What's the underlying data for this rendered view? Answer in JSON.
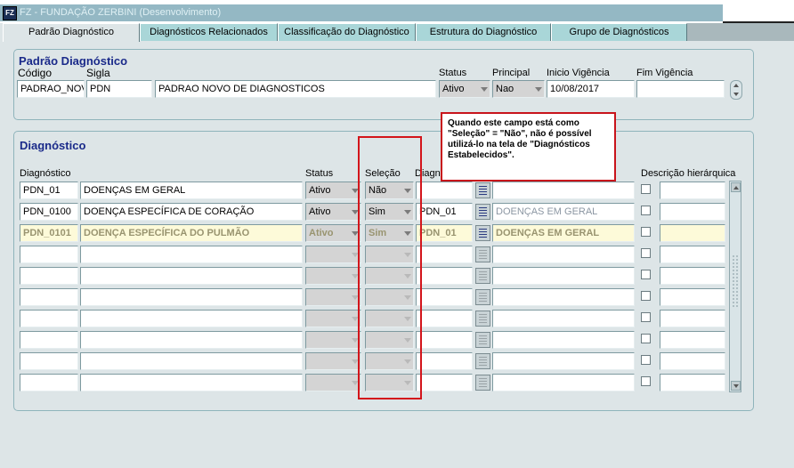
{
  "window": {
    "title": "FZ - FUNDAÇÃO ZERBINI (Desenvolvimento)",
    "icon": "app-icon"
  },
  "tabs": [
    {
      "label": "Padrão Diagnóstico",
      "active": true
    },
    {
      "label": "Diagnósticos Relacionados",
      "active": false
    },
    {
      "label": "Classificação do Diagnóstico",
      "active": false
    },
    {
      "label": "Estrutura do Diagnóstico",
      "active": false
    },
    {
      "label": "Grupo de Diagnósticos",
      "active": false
    }
  ],
  "header": {
    "title": "Padrão Diagnóstico",
    "labels": {
      "codigo": "Código",
      "sigla": "Sigla",
      "status": "Status",
      "principal": "Principal",
      "inicio": "Inicio Vigência",
      "fim": "Fim Vigência"
    },
    "codigo": "PADRAO_NOV",
    "sigla": "PDN",
    "descricao": "PADRAO NOVO DE DIAGNOSTICOS",
    "status": "Ativo",
    "principal": "Nao",
    "inicio": "10/08/2017",
    "fim": ""
  },
  "diag": {
    "title": "Diagnóstico",
    "columns": {
      "diagnostico": "Diagnóstico",
      "status": "Status",
      "selecao": "Seleção",
      "diag_pai": "Diagn",
      "descr_hier": "Descrição hierárquica"
    },
    "rows": [
      {
        "codigo": "PDN_01",
        "descricao": "DOENÇAS EM GERAL",
        "status": "Ativo",
        "selecao": "Não",
        "pai": "",
        "pai_desc": ""
      },
      {
        "codigo": "PDN_0100",
        "descricao": "DOENÇA ESPECÍFICA DE CORAÇÃO",
        "status": "Ativo",
        "selecao": "Sim",
        "pai": "PDN_01",
        "pai_desc": "DOENÇAS EM GERAL"
      },
      {
        "codigo": "PDN_0101",
        "descricao": "DOENÇA ESPECÍFICA DO PULMÃO",
        "status": "Ativo",
        "selecao": "Sim",
        "pai": "PDN_01",
        "pai_desc": "DOENÇAS EM GERAL"
      }
    ],
    "empty_rows": 7
  },
  "callout": "Quando este campo está como \"Seleção\" = \"Não\", não é possível utilizá-lo na tela de \"Diagnósticos Estabelecidos\".",
  "colors": {
    "accent": "#1a2a8a",
    "tab": "#a9d6d8",
    "highlight_row": "#fdfad9",
    "annotation_red": "#d3151b"
  }
}
